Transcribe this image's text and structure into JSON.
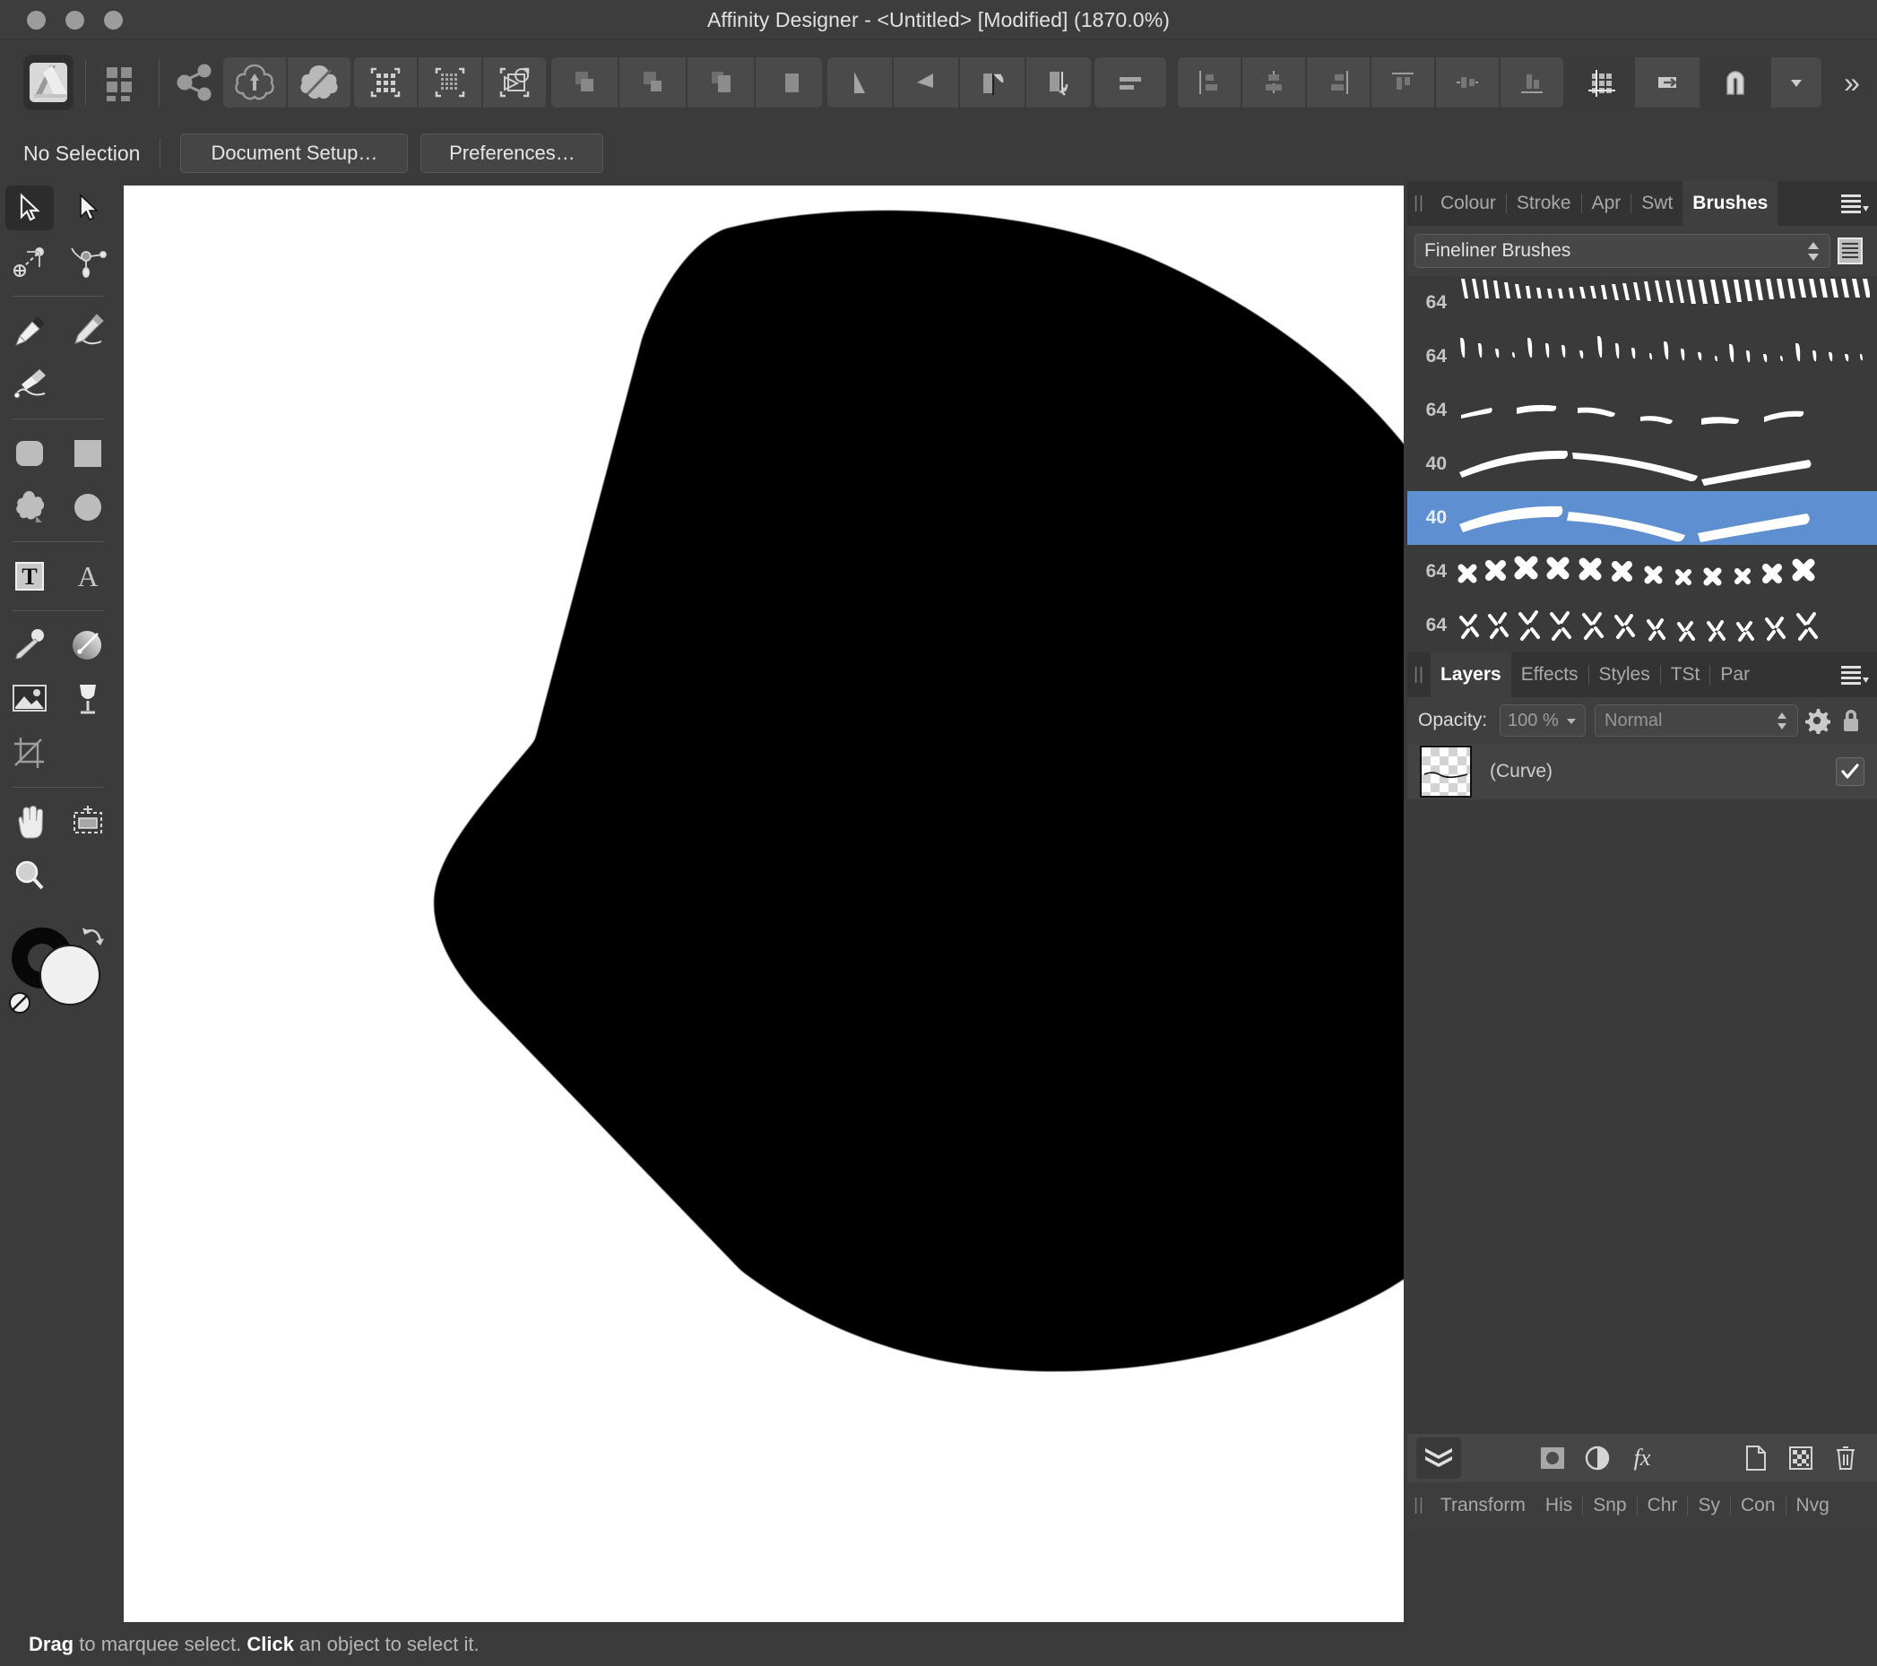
{
  "window": {
    "title": "Affinity Designer - <Untitled> [Modified] (1870.0%)",
    "app_name": "Affinity Designer",
    "document_name": "<Untitled>",
    "modified_flag": "[Modified]",
    "zoom_level": "1870.0%"
  },
  "traffic_lights": [
    {
      "name": "close-button",
      "label": ""
    },
    {
      "name": "minimize-button",
      "label": ""
    },
    {
      "name": "maximize-button",
      "label": ""
    }
  ],
  "toolbar": {
    "groups": [
      {
        "name": "app-icon-group",
        "items": [
          {
            "icon": "affinity-designer-logo-icon",
            "label": ""
          }
        ]
      },
      {
        "name": "persona-group",
        "items": [
          {
            "icon": "grid-squares-icon",
            "label": ""
          }
        ]
      },
      {
        "name": "share-group",
        "items": [
          {
            "icon": "share-nodes-icon",
            "label": ""
          }
        ]
      },
      {
        "name": "geometry-group",
        "items": [
          {
            "icon": "add-to-shape-icon",
            "label": ""
          },
          {
            "icon": "subtract-shape-icon",
            "label": ""
          }
        ]
      },
      {
        "name": "view-mode-group",
        "items": [
          {
            "icon": "pixel-preview-icon",
            "label": ""
          },
          {
            "icon": "retina-preview-icon",
            "label": ""
          },
          {
            "icon": "vector-preview-icon",
            "label": ""
          }
        ]
      },
      {
        "name": "boolean-group",
        "items": [
          {
            "icon": "boolean-add-icon",
            "label": ""
          },
          {
            "icon": "boolean-subtract-icon",
            "label": ""
          },
          {
            "icon": "boolean-intersect-icon",
            "label": ""
          },
          {
            "icon": "boolean-divide-icon",
            "label": ""
          }
        ]
      },
      {
        "name": "transform-group",
        "items": [
          {
            "icon": "flip-horizontal-icon",
            "label": ""
          },
          {
            "icon": "flip-vertical-icon",
            "label": ""
          },
          {
            "icon": "rotate-left-icon",
            "label": ""
          },
          {
            "icon": "rotate-right-icon",
            "label": ""
          }
        ]
      },
      {
        "name": "order-group",
        "items": [
          {
            "icon": "move-to-front-icon",
            "label": ""
          }
        ]
      },
      {
        "name": "align-group",
        "items": [
          {
            "icon": "align-left-icon",
            "label": ""
          },
          {
            "icon": "align-center-horizontal-icon",
            "label": ""
          },
          {
            "icon": "align-right-icon",
            "label": ""
          },
          {
            "icon": "align-top-icon",
            "label": ""
          },
          {
            "icon": "align-middle-vertical-icon",
            "label": ""
          },
          {
            "icon": "align-bottom-icon",
            "label": ""
          }
        ]
      },
      {
        "name": "snapping-group",
        "items": [
          {
            "icon": "grid-toggle-icon",
            "label": ""
          },
          {
            "icon": "move-snapping-icon",
            "label": ""
          },
          {
            "icon": "magnet-snapping-icon",
            "label": ""
          },
          {
            "icon": "chevron-down-icon",
            "label": ""
          }
        ]
      },
      {
        "name": "overflow-group",
        "items": [
          {
            "icon": "double-chevron-right-icon",
            "label": "»"
          }
        ]
      }
    ]
  },
  "context_bar": {
    "selection_status": "No Selection",
    "document_setup_label": "Document Setup…",
    "preferences_label": "Preferences…"
  },
  "tools": [
    {
      "name": "move-tool",
      "icon": "arrow-cursor-icon",
      "active": true
    },
    {
      "name": "node-tool",
      "icon": "solid-arrow-cursor-icon",
      "active": false
    },
    {
      "name": "corner-tool",
      "icon": "corner-node-icon",
      "active": false
    },
    {
      "name": "transform-tool",
      "icon": "transform-handles-icon",
      "active": false
    },
    {
      "name": "pen-tool",
      "icon": "pen-nib-icon",
      "active": false
    },
    {
      "name": "pencil-tool",
      "icon": "pencil-icon",
      "active": false
    },
    {
      "name": "vector-brush-tool",
      "icon": "paintbrush-icon",
      "active": false
    },
    {
      "name": "rounded-rectangle-tool",
      "icon": "rounded-rectangle-icon",
      "active": false
    },
    {
      "name": "rectangle-tool",
      "icon": "rectangle-icon",
      "active": false
    },
    {
      "name": "cog-shape-tool",
      "icon": "cog-flower-shape-icon",
      "active": false
    },
    {
      "name": "ellipse-tool",
      "icon": "ellipse-icon",
      "active": false
    },
    {
      "name": "frame-text-tool",
      "icon": "frame-text-t-icon",
      "active": false
    },
    {
      "name": "artistic-text-tool",
      "icon": "artistic-text-a-icon",
      "active": false
    },
    {
      "name": "colour-picker-tool",
      "icon": "eyedropper-icon",
      "active": false
    },
    {
      "name": "fill-tool",
      "icon": "gradient-fill-icon",
      "active": false
    },
    {
      "name": "place-image-tool",
      "icon": "place-image-icon",
      "active": false
    },
    {
      "name": "vector-flood-fill-tool",
      "icon": "wine-glass-icon",
      "active": false
    },
    {
      "name": "crop-tool",
      "icon": "crop-icon",
      "active": false
    },
    {
      "name": "view-pan-tool",
      "icon": "hand-icon",
      "active": false
    },
    {
      "name": "slice-tool",
      "icon": "slice-export-icon",
      "active": false
    },
    {
      "name": "zoom-tool",
      "icon": "magnifier-icon",
      "active": false
    }
  ],
  "colour_swatches": {
    "stroke_colour": "#000000",
    "fill_colour": "#f0f0f0",
    "swap_icon": "swap-fill-stroke-icon",
    "none_icon": "no-colour-icon"
  },
  "canvas": {
    "background_colour": "#ffffff",
    "shape_colour": "#000000",
    "shape_description": "large black blob shape with pixelated anti-aliased edges"
  },
  "brushes_panel": {
    "tabs": [
      {
        "label": "Colour",
        "active": false
      },
      {
        "label": "Stroke",
        "active": false
      },
      {
        "label": "Apr",
        "active": false
      },
      {
        "label": "Swt",
        "active": false
      },
      {
        "label": "Brushes",
        "active": true
      }
    ],
    "menu_icon": "panel-menu-icon",
    "category_value": "Fineliner Brushes",
    "list_view_icon": "list-view-icon",
    "brushes": [
      {
        "size": "64",
        "style": "dashes-fine",
        "selected": false
      },
      {
        "size": "64",
        "style": "dashes-tapered",
        "selected": false
      },
      {
        "size": "64",
        "style": "short-strokes",
        "selected": false
      },
      {
        "size": "40",
        "style": "smooth-line-thin",
        "selected": false
      },
      {
        "size": "40",
        "style": "smooth-line-bold",
        "selected": true
      },
      {
        "size": "64",
        "style": "crosses-solid",
        "selected": false
      },
      {
        "size": "64",
        "style": "crosses-sketchy",
        "selected": false
      }
    ]
  },
  "layers_panel": {
    "tabs": [
      {
        "label": "Layers",
        "active": true
      },
      {
        "label": "Effects",
        "active": false
      },
      {
        "label": "Styles",
        "active": false
      },
      {
        "label": "TSt",
        "active": false
      },
      {
        "label": "Par",
        "active": false
      }
    ],
    "menu_icon": "panel-menu-icon",
    "opacity_label": "Opacity:",
    "opacity_value": "100 %",
    "blend_mode": "Normal",
    "gear_icon": "gear-icon",
    "lock_icon": "lock-icon",
    "layers": [
      {
        "name": "(Curve)",
        "visible": true,
        "thumbnail": "transparent-checkerboard-with-curve"
      }
    ],
    "bottom_buttons": [
      {
        "name": "layers-stack-button",
        "icon": "layers-stack-icon",
        "active": true
      },
      {
        "name": "mask-layer-button",
        "icon": "mask-layer-icon",
        "active": false
      },
      {
        "name": "adjustment-layer-button",
        "icon": "adjustment-half-circle-icon",
        "active": false
      },
      {
        "name": "effects-button",
        "icon": "fx-icon",
        "label": "fx",
        "active": false
      },
      {
        "name": "add-layer-button",
        "icon": "new-document-icon",
        "active": false
      },
      {
        "name": "add-pixel-layer-button",
        "icon": "checkerboard-layer-icon",
        "active": false
      },
      {
        "name": "delete-layer-button",
        "icon": "trash-icon",
        "active": false
      }
    ]
  },
  "studio_tabs": [
    {
      "label": "Transform",
      "active": false
    },
    {
      "label": "His",
      "active": false
    },
    {
      "label": "Snp",
      "active": false
    },
    {
      "label": "Chr",
      "active": false
    },
    {
      "label": "Sy",
      "active": false
    },
    {
      "label": "Con",
      "active": false
    },
    {
      "label": "Nvg",
      "active": false
    }
  ],
  "status_bar": {
    "drag_word": "Drag",
    "middle_text": " to marquee select. ",
    "click_word": "Click",
    "end_text": " an object to select it."
  },
  "colors": {
    "chrome": "#3b3b3b",
    "panel_dark": "#333333",
    "selection_blue": "#5e8fd0",
    "text_primary": "#e4e4e4",
    "text_muted": "#a9a9a9"
  }
}
